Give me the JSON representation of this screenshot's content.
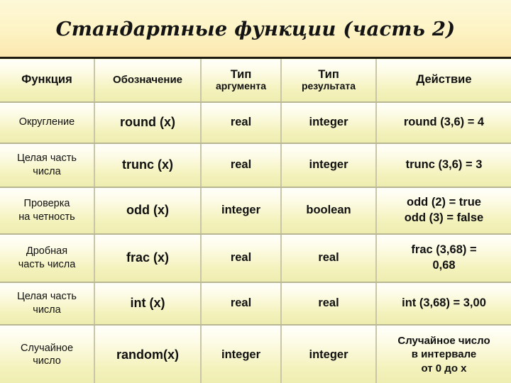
{
  "slide": {
    "title": "Стандартные функции (часть 2)"
  },
  "table": {
    "headers": {
      "function": "Функция",
      "notation": "Обозначение",
      "arg_type_line1": "Тип",
      "arg_type_line2": "аргумента",
      "result_type_line1": "Тип",
      "result_type_line2": "результата",
      "action": "Действие"
    },
    "rows": [
      {
        "function": [
          "Округление"
        ],
        "notation": "round (x)",
        "arg_type": "real",
        "result_type": "integer",
        "action": [
          "round (3,6) = 4"
        ]
      },
      {
        "function": [
          "Целая часть",
          "числа"
        ],
        "notation": "trunc (x)",
        "arg_type": "real",
        "result_type": "integer",
        "action": [
          "trunc (3,6) = 3"
        ]
      },
      {
        "function": [
          "Проверка",
          "на четность"
        ],
        "notation": "odd (x)",
        "arg_type": "integer",
        "result_type": "boolean",
        "action": [
          "odd (2) = true",
          "odd (3) = false"
        ]
      },
      {
        "function": [
          "Дробная",
          "часть числа"
        ],
        "notation": "frac (x)",
        "arg_type": "real",
        "result_type": "real",
        "action": [
          "frac (3,68) =",
          "0,68"
        ]
      },
      {
        "function": [
          "Целая часть",
          "числа"
        ],
        "notation": "int (x)",
        "arg_type": "real",
        "result_type": "real",
        "action": [
          "int (3,68) = 3,00"
        ]
      },
      {
        "function": [
          "Случайное",
          "число"
        ],
        "notation": "random(x)",
        "arg_type": "integer",
        "result_type": "integer",
        "action": [
          "Случайное число",
          "в интервале",
          "от 0 до х"
        ]
      }
    ]
  },
  "colors": {
    "background_top": "#fdf7d4",
    "background_bottom": "#fae8b4",
    "cell_top": "#fffffb",
    "cell_bottom": "#eeedb0",
    "border_dark": "#1d1a10",
    "border_grid": "#b9b693",
    "text": "#101010"
  }
}
